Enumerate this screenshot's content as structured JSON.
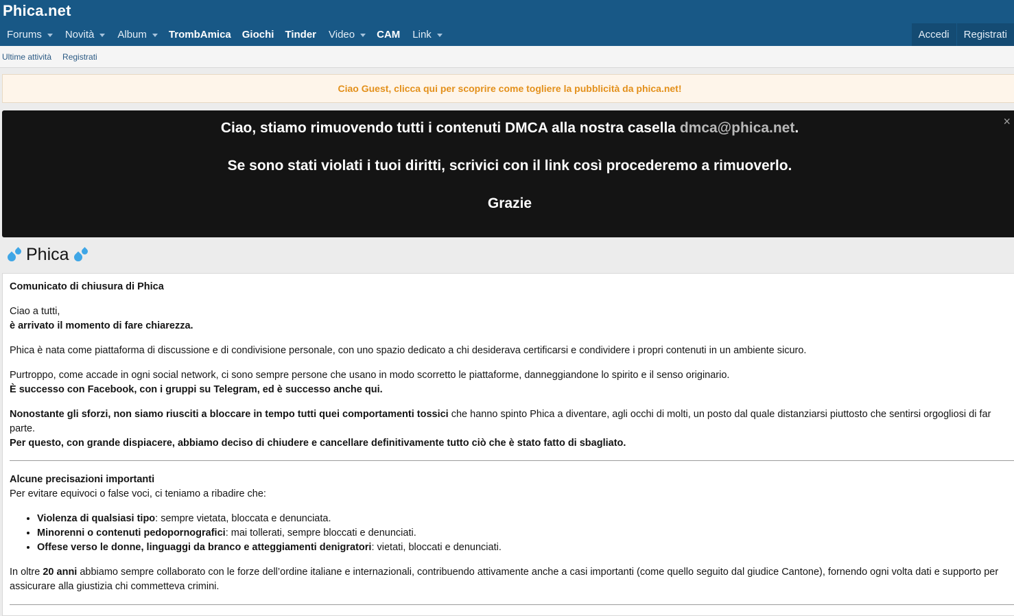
{
  "site": {
    "logo": "Phica.net"
  },
  "nav": {
    "items": [
      {
        "label": "Forums",
        "dropdown": true,
        "bold": false
      },
      {
        "label": "Novità",
        "dropdown": true,
        "bold": false
      },
      {
        "label": "Album",
        "dropdown": true,
        "bold": false
      },
      {
        "label": "TrombAmica",
        "dropdown": false,
        "bold": true
      },
      {
        "label": "Giochi",
        "dropdown": false,
        "bold": true
      },
      {
        "label": "Tinder",
        "dropdown": false,
        "bold": true
      },
      {
        "label": "Video",
        "dropdown": true,
        "bold": false
      },
      {
        "label": "CAM",
        "dropdown": false,
        "bold": true
      },
      {
        "label": "Link",
        "dropdown": true,
        "bold": false
      }
    ],
    "login": "Accedi",
    "register": "Registrati"
  },
  "subnav": {
    "recent": "Ultime attività",
    "register": "Registrati"
  },
  "ad_notice": "Ciao Guest, clicca qui per scoprire come togliere la pubblicità da phica.net!",
  "dmca": {
    "line1_pre": "Ciao, stiamo rimuovendo tutti i contenuti DMCA alla nostra casella ",
    "email": "dmca@phica.net",
    "line1_post": ".",
    "line2": "Se sono stati violati i tuoi diritti, scrivici con il link così procederemo a rimuoverlo.",
    "line3": "Grazie",
    "close": "×"
  },
  "page_title": "Phica",
  "post": {
    "heading": "Comunicato di chiusura di Phica",
    "greeting": "Ciao a tutti,",
    "greeting_bold": "è arrivato il momento di fare chiarezza.",
    "p1": "Phica è nata come piattaforma di discussione e di condivisione personale, con uno spazio dedicato a chi desiderava certificarsi e condividere i propri contenuti in un ambiente sicuro.",
    "p2": "Purtroppo, come accade in ogni social network, ci sono sempre persone che usano in modo scorretto le piattaforme, danneggiandone lo spirito e il senso originario.",
    "p2_bold": "È successo con Facebook, con i gruppi su Telegram, ed è successo anche qui.",
    "p3_bold": "Nonostante gli sforzi, non siamo riusciti a bloccare in tempo tutti quei comportamenti tossici",
    "p3_rest": " che hanno spinto Phica a diventare, agli occhi di molti, un posto dal quale distanziarsi piuttosto che sentirsi orgogliosi di far parte.",
    "p3_bold2": "Per questo, con grande dispiacere, abbiamo deciso di chiudere e cancellare definitivamente tutto ciò che è stato fatto di sbagliato.",
    "section_title": "Alcune precisazioni importanti",
    "section_intro": "Per evitare equivoci o false voci, ci teniamo a ribadire che:",
    "bullets": [
      {
        "bold": "Violenza di qualsiasi tipo",
        "rest": ": sempre vietata, bloccata e denunciata."
      },
      {
        "bold": "Minorenni o contenuti pedopornografici",
        "rest": ": mai tollerati, sempre bloccati e denunciati."
      },
      {
        "bold": "Offese verso le donne, linguaggi da branco e atteggiamenti denigratori",
        "rest": ": vietati, bloccati e denunciati."
      }
    ],
    "p4_pre": "In oltre ",
    "p4_bold": "20 anni",
    "p4_rest": " abbiamo sempre collaborato con le forze dell’ordine italiane e internazionali, contribuendo attivamente anche a casi importanti (come quello seguito dal giudice Cantone), fornendo ogni volta dati e supporto per assicurare alla giustizia chi commetteva crimini."
  },
  "colors": {
    "header": "#185886",
    "accent_notice": "#e3901b",
    "dmca_bg": "#141414"
  }
}
